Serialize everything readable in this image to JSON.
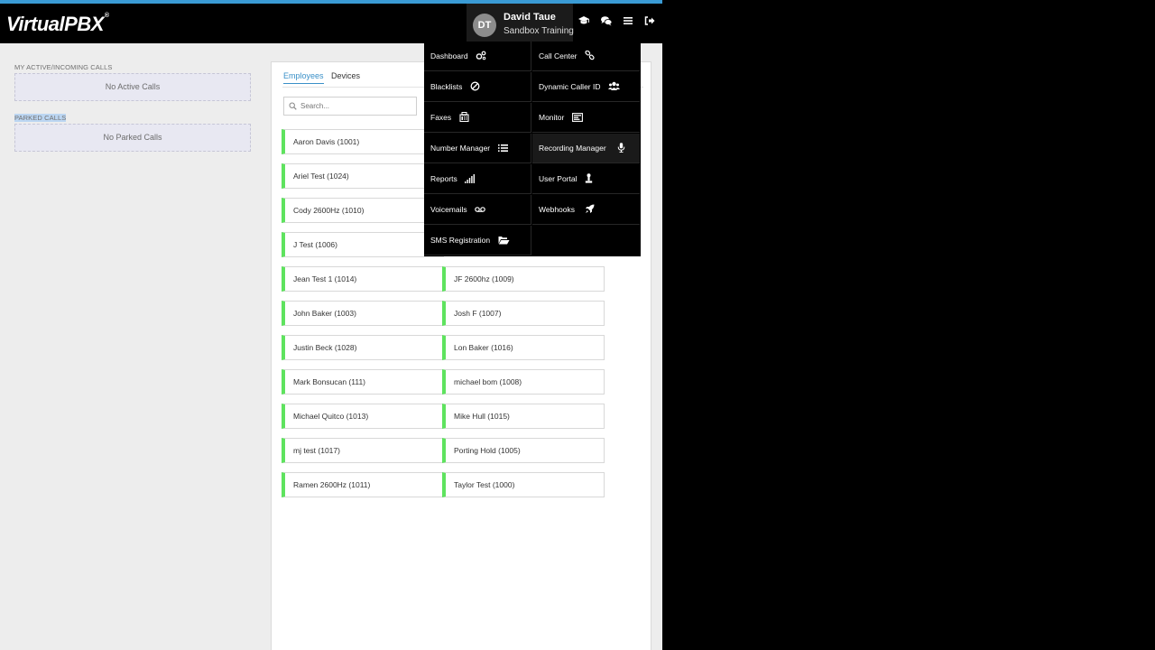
{
  "app": {
    "logo_text": "VirtualPBX",
    "logo_mark": "®"
  },
  "header": {
    "user": {
      "initials": "DT",
      "name": "David Taue",
      "subtitle": "Sandbox Training"
    },
    "icons": [
      "graduation-cap-icon",
      "chat-icon",
      "hamburger-menu-icon",
      "logout-icon"
    ]
  },
  "left": {
    "active_calls_label": "MY ACTIVE/INCOMING CALLS",
    "active_calls_empty": "No Active Calls",
    "parked_calls_label": "PARKED CALLS",
    "parked_calls_empty": "No Parked Calls"
  },
  "panel": {
    "tabs": [
      "Employees",
      "Devices"
    ],
    "active_tab": "Employees",
    "search_placeholder": "Search...",
    "status_color": "#5ee35e",
    "employees_left": [
      "Aaron Davis (1001)",
      "Ariel Test (1024)",
      "Cody 2600Hz (1010)",
      "J Test (1006)",
      "Jean Test 1 (1014)",
      "John Baker (1003)",
      "Justin Beck (1028)",
      "Mark Bonsucan (111)",
      "Michael Quitco (1013)",
      "mj test (1017)",
      "Ramen 2600Hz (1011)"
    ],
    "employees_right": [
      "JF 2600hz (1009)",
      "Josh F (1007)",
      "Lon Baker (1016)",
      "michael bom (1008)",
      "Mike Hull (1015)",
      "Porting Hold (1005)",
      "Taylor Test (1000)"
    ]
  },
  "menu": {
    "items": [
      {
        "label": "Dashboard",
        "icon": "gears-icon"
      },
      {
        "label": "Call Center",
        "icon": "link-icon"
      },
      {
        "label": "Blacklists",
        "icon": "ban-icon"
      },
      {
        "label": "Dynamic Caller ID",
        "icon": "users-icon"
      },
      {
        "label": "Faxes",
        "icon": "fax-icon"
      },
      {
        "label": "Monitor",
        "icon": "monitor-icon"
      },
      {
        "label": "Number Manager",
        "icon": "list-icon"
      },
      {
        "label": "Recording Manager",
        "icon": "microphone-icon"
      },
      {
        "label": "Reports",
        "icon": "signal-bars-icon"
      },
      {
        "label": "User Portal",
        "icon": "user-portal-icon"
      },
      {
        "label": "Voicemails",
        "icon": "voicemail-icon"
      },
      {
        "label": "Webhooks",
        "icon": "rocket-icon"
      },
      {
        "label": "SMS Registration",
        "icon": "folder-open-icon"
      }
    ],
    "active_item": "Recording Manager"
  }
}
